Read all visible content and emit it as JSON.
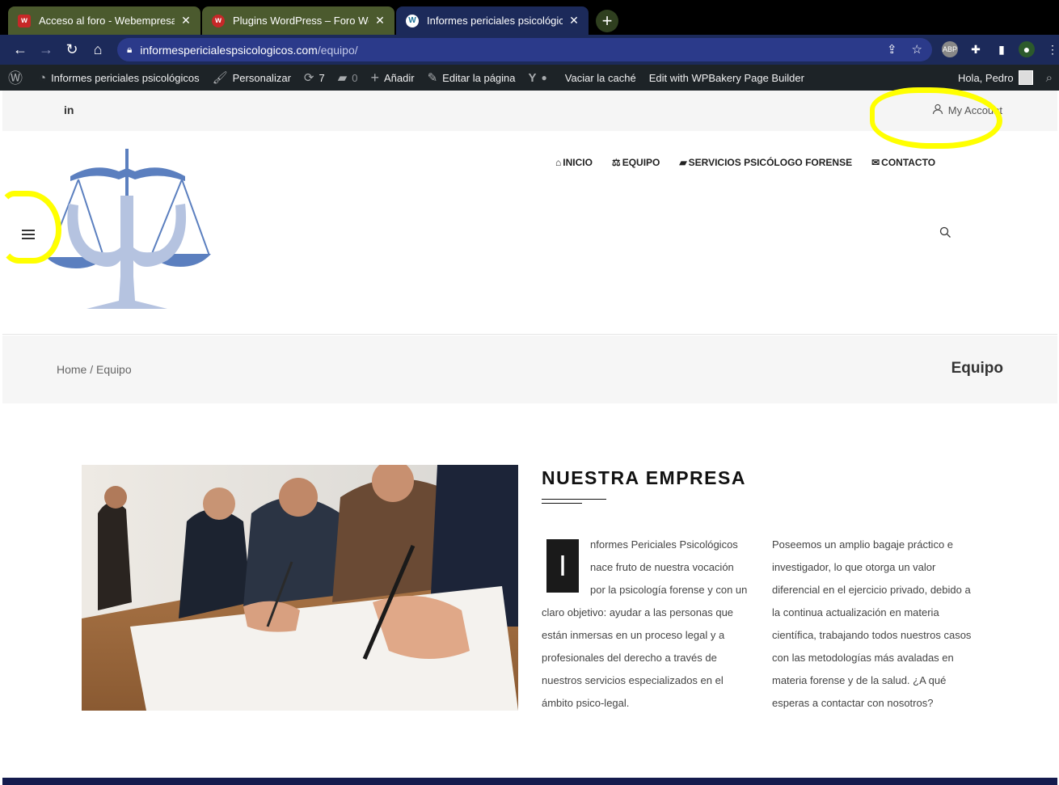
{
  "browser": {
    "tabs": [
      {
        "title": "Acceso al foro - Webempresa Eur",
        "icon": "webempresa-favicon"
      },
      {
        "title": "Plugins WordPress – Foro Webem",
        "icon": "webempresa-favicon"
      },
      {
        "title": "Informes periciales psicológicos -",
        "icon": "wordpress-favicon"
      }
    ],
    "url_domain": "informespericialespsicologicos.com",
    "url_path": "/equipo/"
  },
  "adminbar": {
    "site_name": "Informes periciales psicológicos",
    "customize": "Personalizar",
    "updates_count": "7",
    "comments_count": "0",
    "add_new": "Añadir",
    "edit_page": "Editar la página",
    "clear_cache": "Vaciar la caché",
    "wpbakery": "Edit with WPBakery Page Builder",
    "greeting": "Hola, Pedro"
  },
  "topbar": {
    "linkedin": "in",
    "account": "My Account"
  },
  "nav": [
    {
      "label": "INICIO",
      "icon": "home-icon"
    },
    {
      "label": "EQUIPO",
      "icon": "balance-scale-icon"
    },
    {
      "label": "SERVICIOS PSICÓLOGO FORENSE",
      "icon": "folder-open-icon"
    },
    {
      "label": "CONTACTO",
      "icon": "envelope-icon"
    }
  ],
  "titlebar": {
    "breadcrumb_home": "Home",
    "breadcrumb_sep": " / ",
    "breadcrumb_current": "Equipo",
    "title": "Equipo"
  },
  "content": {
    "heading": "NUESTRA EMPRESA",
    "dropcap": "I",
    "col1_text": "nformes Periciales Psicológicos nace fruto de nuestra vocación por la psicología forense y con un claro objetivo: ayudar a las personas que están inmersas en un proceso legal y a profesionales del derecho a través de nuestros servicios especializados en el ámbito psico-legal.",
    "col2_text": "Poseemos un amplio bagaje práctico e investigador, lo que otorga un valor diferencial en el ejercicio privado, debido a la continua actualización en materia científica, trabajando todos nuestros casos con las metodologías más avaladas en materia forense y de la salud. ¿A qué esperas a contactar con nosotros?"
  },
  "colors": {
    "accent_blue": "#5b7fbf",
    "adminbar_bg": "#1d2327",
    "highlight": "#ffff00"
  }
}
